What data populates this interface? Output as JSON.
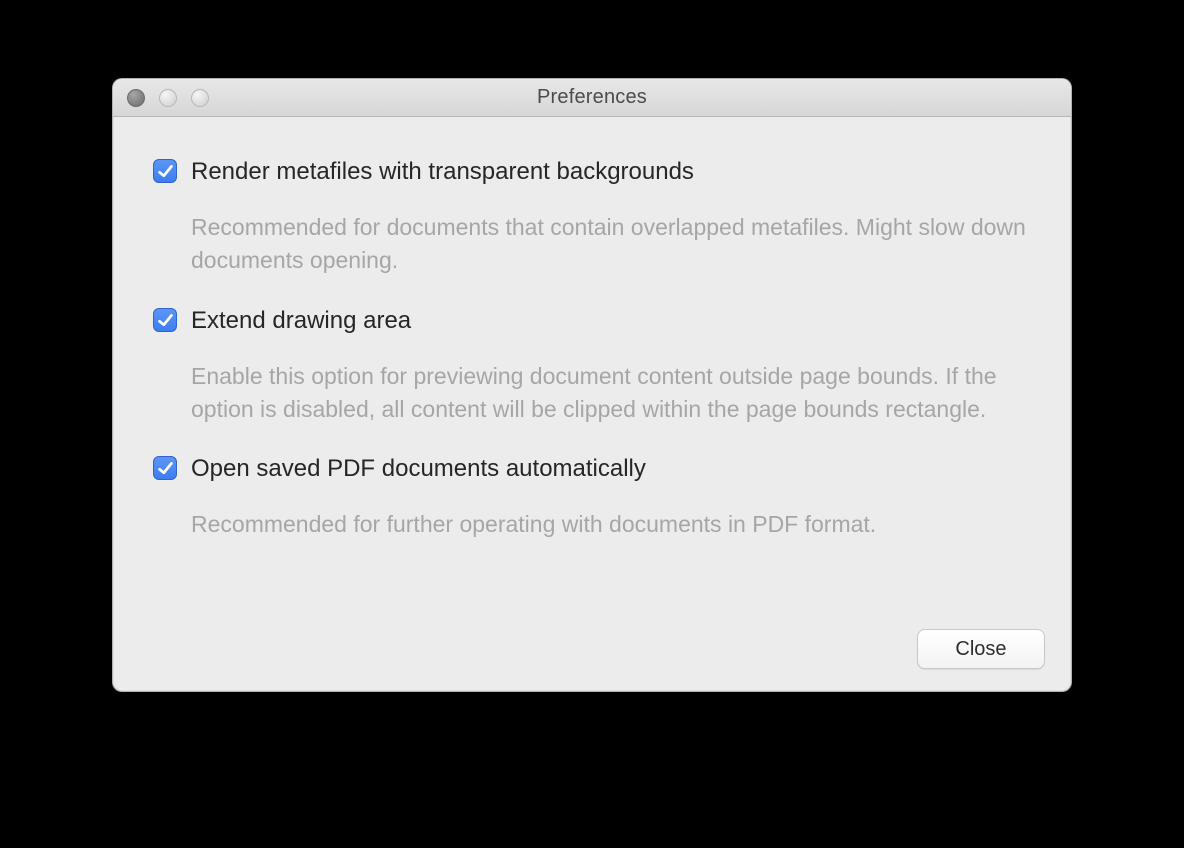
{
  "window": {
    "title": "Preferences"
  },
  "options": [
    {
      "checked": true,
      "label": "Render metafiles with transparent backgrounds",
      "description": "Recommended for documents that contain overlapped metafiles. Might slow down documents opening."
    },
    {
      "checked": true,
      "label": "Extend drawing area",
      "description": "Enable this option for previewing document content outside page bounds. If the option is disabled, all content will be clipped within the page bounds rectangle."
    },
    {
      "checked": true,
      "label": "Open saved PDF documents automatically",
      "description": "Recommended for further operating with documents in PDF format."
    }
  ],
  "buttons": {
    "close": "Close"
  }
}
